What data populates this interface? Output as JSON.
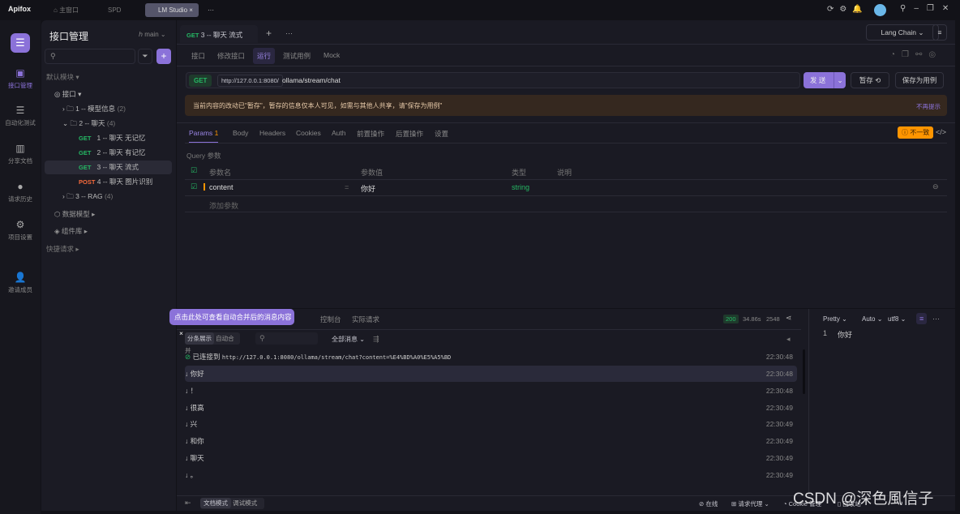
{
  "app": {
    "name": "Apifox"
  },
  "tabs": [
    {
      "label": "主窗口"
    },
    {
      "label": "SPD"
    },
    {
      "label": "LM Studio"
    }
  ],
  "rail": [
    {
      "label": "接口管理",
      "icon": "api-icon"
    },
    {
      "label": "自动化测试",
      "icon": "stack-icon"
    },
    {
      "label": "分享文档",
      "icon": "book-icon"
    },
    {
      "label": "请求历史",
      "icon": "clock-icon"
    },
    {
      "label": "项目设置",
      "icon": "gear-icon"
    },
    {
      "label": "邀请成员",
      "icon": "user-plus-icon"
    }
  ],
  "tree": {
    "title": "接口管理",
    "branch": "main",
    "module": "默认模块",
    "root": "接口",
    "items": [
      {
        "label": "1 -- 模型信息",
        "count": "(2)"
      },
      {
        "label": "2 -- 聊天",
        "count": "(4)"
      },
      {
        "method": "GET",
        "label": "1 -- 聊天 无记忆"
      },
      {
        "method": "GET",
        "label": "2 -- 聊天 有记忆"
      },
      {
        "method": "GET",
        "label": "3 -- 聊天 流式"
      },
      {
        "method": "POST",
        "label": "4 -- 聊天 图片识别"
      },
      {
        "label": "3 -- RAG",
        "count": "(4)"
      }
    ],
    "data_model": "数据模型",
    "components": "组件库",
    "quick": "快捷请求"
  },
  "main": {
    "tab_method": "GET",
    "tab_title": "3 -- 聊天 流式",
    "env": "Lang Chain",
    "subtabs": [
      "接口",
      "修改接口",
      "运行",
      "测试用例",
      "Mock"
    ],
    "method": "GET",
    "base_url": "http://127.0.0.1:8080/",
    "path": "ollama/stream/chat",
    "send": "发 送",
    "save_temp": "暂存",
    "save_case": "保存为用例",
    "notice": "当前内容的改动已\"暂存\"，暂存的信息仅本人可见，如需与其他人共享，请\"保存为用例\"",
    "notice_dismiss": "不再提示",
    "ptabs": [
      "Params",
      "Body",
      "Headers",
      "Cookies",
      "Auth",
      "前置操作",
      "后置操作",
      "设置"
    ],
    "params_count": "1",
    "mismatch": "不一致",
    "query_label": "Query 参数",
    "cols": [
      "参数名",
      "参数值",
      "类型",
      "说明"
    ],
    "param": {
      "name": "content",
      "value": "你好",
      "type": "string"
    },
    "add_param": "添加参数"
  },
  "bottom": {
    "tooltip": "点击此处可查看自动合并后的消息内容",
    "tabs": [
      "控制台",
      "实际请求"
    ],
    "status": "200",
    "time": "34.86s",
    "size": "2548",
    "modes": [
      "分条展示",
      "自动合并"
    ],
    "filter": "全部消息",
    "connected": "已连接到",
    "url": "http://127.0.0.1:8080/ollama/stream/chat?content=%E4%BD%A0%E5%A5%BD",
    "connected_time": "22:30:48",
    "messages": [
      {
        "text": "你好",
        "time": "22:30:48"
      },
      {
        "text": "！",
        "time": "22:30:48"
      },
      {
        "text": "很高",
        "time": "22:30:49"
      },
      {
        "text": "兴",
        "time": "22:30:49"
      },
      {
        "text": "和你",
        "time": "22:30:49"
      },
      {
        "text": "聊天",
        "time": "22:30:49"
      },
      {
        "text": "。",
        "time": "22:30:49"
      }
    ],
    "view": {
      "format": "Pretty",
      "auto": "Auto",
      "encoding": "utf8",
      "line": "1",
      "content": "你好"
    }
  },
  "statusbar": {
    "modes": [
      "文档模式",
      "调试模式"
    ],
    "online": "在线",
    "proxy": "请求代理",
    "cookie": "Cookie 管理",
    "recycle": "回收站"
  },
  "watermark": "CSDN @深色風信子",
  "colors": {
    "accent": "#8b72d9",
    "get": "#25b864",
    "post": "#f76b3c",
    "warning": "#ff9500"
  }
}
